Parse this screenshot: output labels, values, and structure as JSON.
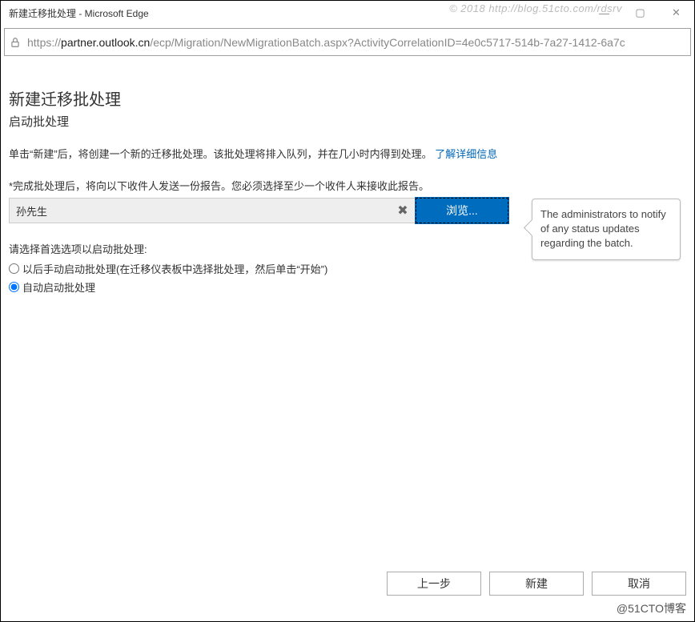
{
  "window": {
    "title": "新建迁移批处理 - Microsoft Edge"
  },
  "watermarks": {
    "top": "© 2018 http://blog.51cto.com/rdsrv",
    "bottom": "@51CTO博客"
  },
  "url": {
    "scheme": "https://",
    "host": "partner.outlook.cn",
    "path": "/ecp/Migration/NewMigrationBatch.aspx?ActivityCorrelationID=4e0c5717-514b-7a27-1412-6a7c"
  },
  "page": {
    "heading": "新建迁移批处理",
    "subheading": "启动批处理",
    "intro_text": "单击“新建”后，将创建一个新的迁移批处理。该批处理将排入队列，并在几小时内得到处理。",
    "learn_more": "了解详细信息",
    "recipient_label": "*完成批处理后，将向以下收件人发送一份报告。您必须选择至少一个收件人来接收此报告。",
    "recipient_value": "孙先生",
    "browse": "浏览...",
    "callout": "The administrators to notify of any status updates regarding the batch.",
    "options_label": "请选择首选选项以启动批处理:",
    "option_manual": "以后手动启动批处理(在迁移仪表板中选择批处理，然后单击“开始”)",
    "option_auto": "自动启动批处理"
  },
  "buttons": {
    "back": "上一步",
    "create": "新建",
    "cancel": "取消"
  }
}
